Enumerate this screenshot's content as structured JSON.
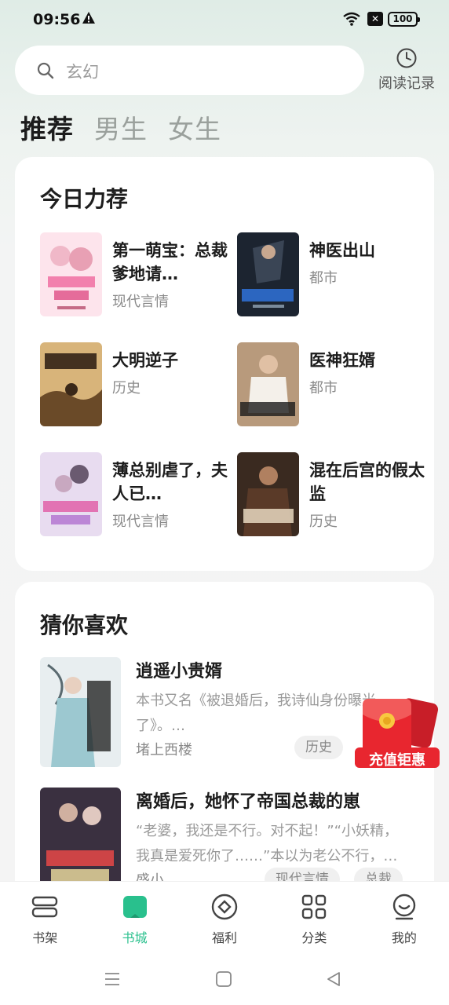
{
  "status_bar": {
    "time": "09:56",
    "battery": "100"
  },
  "search": {
    "placeholder": "玄幻",
    "history_label": "阅读记录"
  },
  "tabs": [
    {
      "label": "推荐",
      "active": true
    },
    {
      "label": "男生",
      "active": false
    },
    {
      "label": "女生",
      "active": false
    }
  ],
  "recommend": {
    "title": "今日力荐",
    "books": [
      {
        "title": "第一萌宝：总裁爹地请…",
        "genre": "现代言情"
      },
      {
        "title": "神医出山",
        "genre": "都市"
      },
      {
        "title": "大明逆子",
        "genre": "历史"
      },
      {
        "title": "医神狂婿",
        "genre": "都市"
      },
      {
        "title": "薄总别虐了，夫人已…",
        "genre": "现代言情"
      },
      {
        "title": "混在后宫的假太监",
        "genre": "历史"
      }
    ]
  },
  "guess": {
    "title": "猜你喜欢",
    "books": [
      {
        "title": "逍遥小贵婿",
        "desc": "本书又名《被退婚后，我诗仙身份曝光了》。…",
        "author": "堵上西楼",
        "tags": [
          "历史"
        ]
      },
      {
        "title": "离婚后，她怀了帝国总裁的崽",
        "desc": "“老婆，我还是不行。对不起！”“小妖精，我真是爱死你了……”本以为老公不行，…",
        "author": "盛小",
        "tags": [
          "现代言情",
          "总裁"
        ]
      }
    ]
  },
  "float_promo": {
    "label": "充值钜惠"
  },
  "bottom_nav": [
    {
      "label": "书架",
      "icon": "bookshelf-icon",
      "active": false
    },
    {
      "label": "书城",
      "icon": "book-open-icon",
      "active": true
    },
    {
      "label": "福利",
      "icon": "welfare-icon",
      "active": false
    },
    {
      "label": "分类",
      "icon": "grid-icon",
      "active": false
    },
    {
      "label": "我的",
      "icon": "profile-icon",
      "active": false
    }
  ],
  "colors": {
    "accent": "#29c08d",
    "promo_red": "#e8262f"
  }
}
